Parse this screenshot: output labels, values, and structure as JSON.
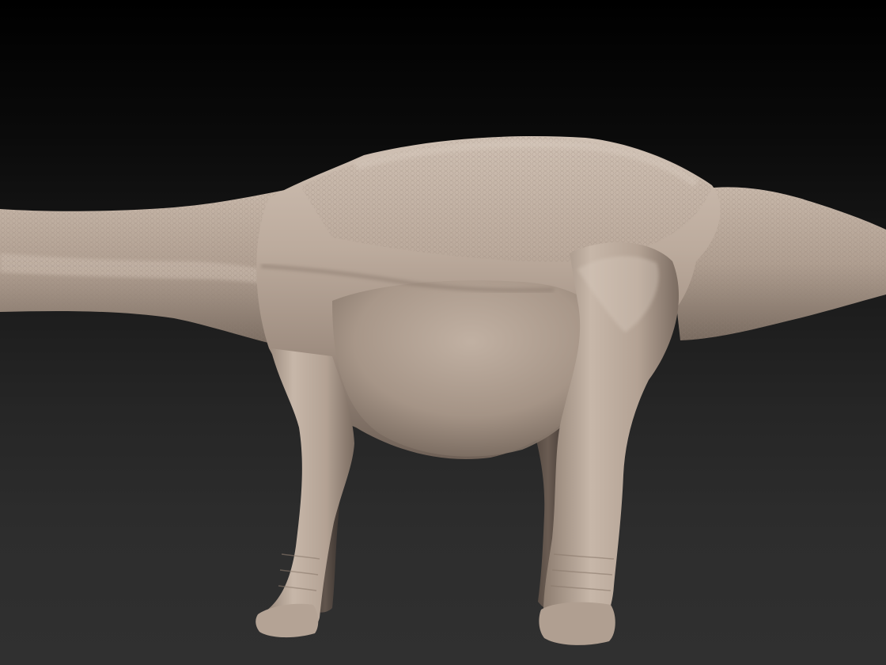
{
  "scene": {
    "subject": "sauropod-sculpt",
    "colors": {
      "background_top": "#000000",
      "background_bottom": "#303030",
      "clay_light": "#cdbcae",
      "clay_mid": "#a59587",
      "clay_shadow": "#5e5249",
      "clay_deep": "#3a322c"
    }
  }
}
